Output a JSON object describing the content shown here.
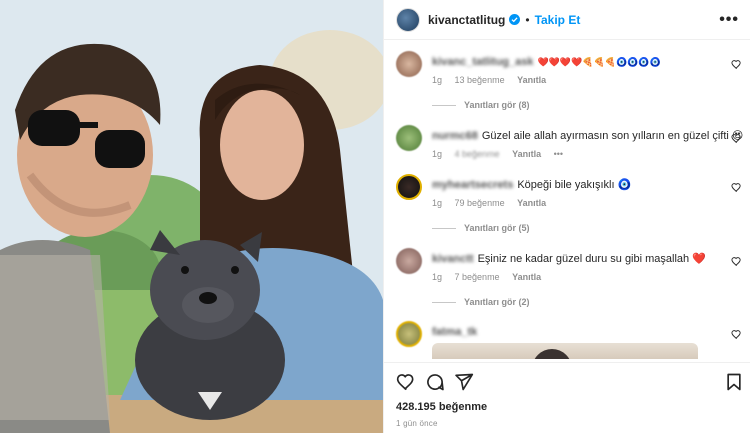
{
  "post": {
    "username": "kivanctatlitug",
    "follow_label": "Takip Et",
    "more_label": "•••",
    "likes": "428.195 beğenme",
    "time": "1 gün önce"
  },
  "comments": [
    {
      "user": "kivanc_tatlitug_ask",
      "text": "❤️❤️❤️❤️🍕🍕🍕🧿🧿🧿🧿",
      "time": "1g",
      "likes": "13 beğenme",
      "reply": "Yanıtla",
      "replies": "Yanıtları gör (8)"
    },
    {
      "user": "nurmc68",
      "text": "Güzel aile allah ayırmasın son yılların en güzel çifti 😍",
      "time": "1g",
      "likes": "4 beğenme",
      "reply": "Yanıtla",
      "more": "•••"
    },
    {
      "user": "myheartsecrets",
      "text": "Köpeği bile yakışıklı 🧿",
      "time": "1g",
      "likes": "79 beğenme",
      "reply": "Yanıtla",
      "replies": "Yanıtları gör (5)"
    },
    {
      "user": "kivanctt",
      "text": "Eşiniz ne kadar güzel duru su gibi maşallah ❤️",
      "time": "1g",
      "likes": "7 beğenme",
      "reply": "Yanıtla",
      "replies": "Yanıtları gör (2)"
    },
    {
      "user": "fatma_tk",
      "text": ""
    }
  ],
  "icons": [
    "verified-badge-icon",
    "heart-icon",
    "comment-icon",
    "share-icon",
    "bookmark-icon"
  ],
  "colors": {
    "accent": "#0095f6",
    "text": "#262626",
    "muted": "#8e8e8e",
    "border": "#efefef"
  }
}
